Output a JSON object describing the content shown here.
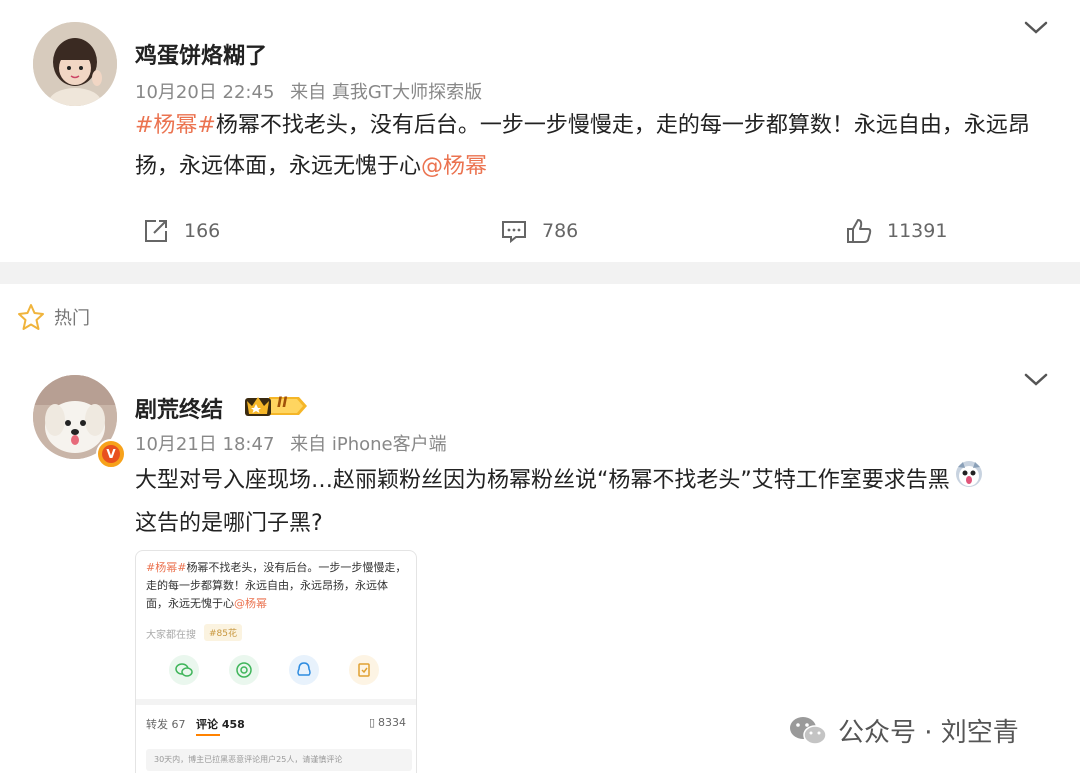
{
  "post": {
    "username": "鸡蛋饼烙糊了",
    "date": "10月20日 22:45",
    "source": "来自 真我GT大师探索版",
    "text_tag": "#杨幂#",
    "text_body": "杨幂不找老头，没有后台。一步一步慢慢走，走的每一步都算数！永远自由，永远昂扬，永远体面，永远无愧于心",
    "text_mention": "@杨幂",
    "reposts": "166",
    "comments": "786",
    "likes": "11391"
  },
  "hot_section": {
    "label": "热门"
  },
  "comment": {
    "username": "剧荒终结",
    "level_badge": "II",
    "verified_badge": "V",
    "date": "10月21日 18:47",
    "source": "来自 iPhone客户端",
    "text_line1": "大型对号入座现场…赵丽颖粉丝因为杨幂粉丝说“杨幂不找老头”艾特工作室要求告黑",
    "text_line2": "这告的是哪门子黑?",
    "embedded": {
      "text_tag": "#杨幂#",
      "text_body": "杨幂不找老头，没有后台。一步一步慢慢走，走的每一步都算数！永远自由，永远昂扬，永远体面，永远无愧于心",
      "text_mention": "@杨幂",
      "hint": "大家都在搜",
      "hint_tag": "#85花",
      "repost_label": "转发 67",
      "comment_label": "评论 458",
      "like_label": "8334",
      "note": "30天内，博主已拉黑恶意评论用户25人，请谨慎评论"
    }
  },
  "watermark": {
    "text": "公众号 · 刘空青"
  },
  "colors": {
    "accent": "#eb7350",
    "orange": "#ff8200",
    "meta": "#888888"
  }
}
